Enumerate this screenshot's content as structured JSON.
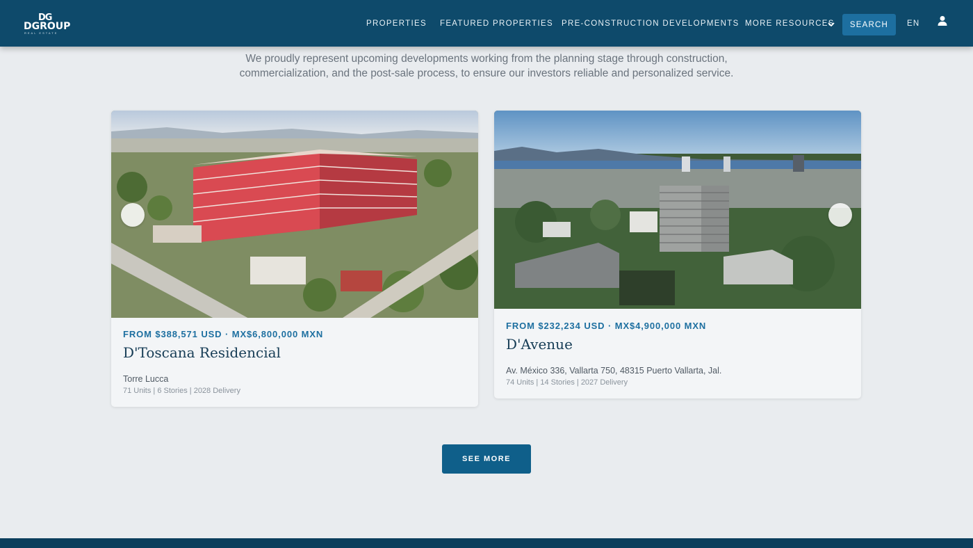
{
  "nav": {
    "logo_mark": "DG",
    "logo_word": "DGROUP",
    "logo_sub": "REAL ESTATE",
    "links": [
      "PROPERTIES",
      "FEATURED PROPERTIES",
      "PRE-CONSTRUCTION DEVELOPMENTS",
      "MORE RESOURCES"
    ],
    "search_label": "SEARCH",
    "language": "EN",
    "icons": [
      "chevron-down-icon",
      "user-icon"
    ]
  },
  "intro": {
    "line1": "We proudly represent upcoming developments working from the planning stage through construction,",
    "line2": "commercialization, and the post-sale process, to ensure our investors reliable and personalized service."
  },
  "cards": [
    {
      "price": "FROM $388,571 USD · MX$6,800,000 MXN",
      "title": "D'Toscana Residencial",
      "subtitle": "Torre Lucca",
      "meta": "71 Units | 6 Stories | 2028 Delivery"
    },
    {
      "price": "FROM $232,234 USD · MX$4,900,000 MXN",
      "title": "D'Avenue",
      "subtitle": "Av. México 336, Vallarta 750, 48315 Puerto Vallarta, Jal.",
      "meta": "74 Units | 14 Stories | 2027 Delivery"
    }
  ],
  "see_more": "SEE MORE",
  "colors": {
    "nav_bg": "#0e4a6b",
    "accent": "#1d6fa0",
    "page_bg": "#e9ecef",
    "footer": "#0b3e5c"
  }
}
